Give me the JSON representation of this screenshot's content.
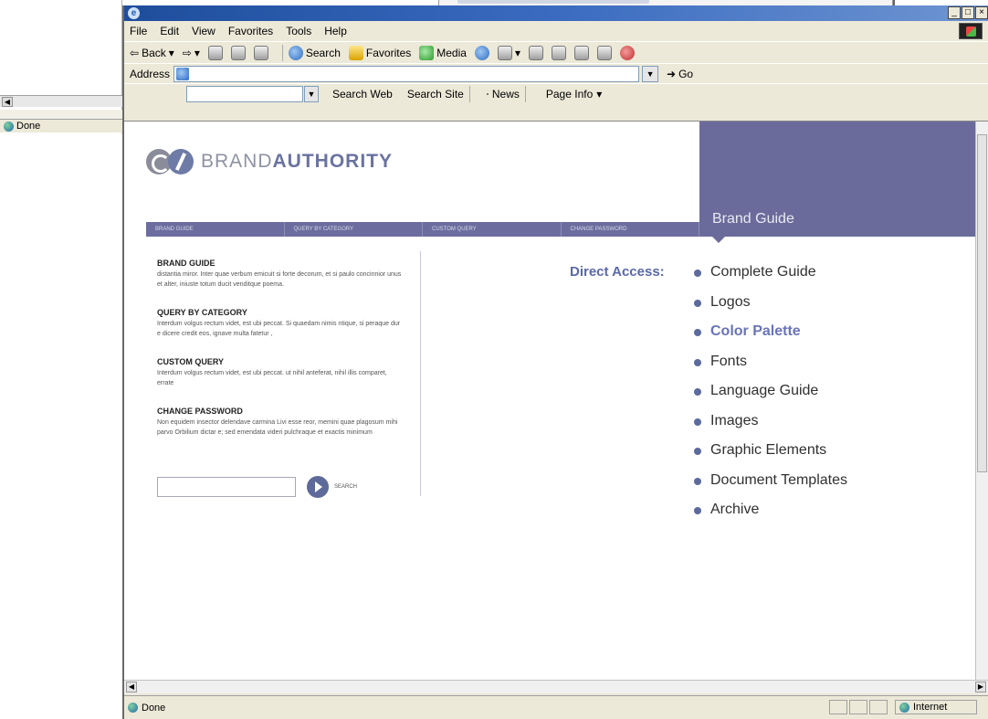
{
  "background_window": {
    "status": "Done"
  },
  "browser": {
    "menu": [
      "File",
      "Edit",
      "View",
      "Favorites",
      "Tools",
      "Help"
    ],
    "toolbar": {
      "back": "Back",
      "search": "Search",
      "favorites": "Favorites",
      "media": "Media"
    },
    "address_label": "Address",
    "address_value": "",
    "go": "Go",
    "links": {
      "search_web": "Search Web",
      "search_site": "Search Site",
      "news": "News",
      "page_info": "Page Info"
    },
    "status": "Done",
    "zone": "Internet"
  },
  "page": {
    "brand_light": "BRAND",
    "brand_bold": "AUTHORITY",
    "nav": [
      "BRAND GUIDE",
      "QUERY BY CATEGORY",
      "CUSTOM QUERY",
      "CHANGE PASSWORD"
    ],
    "panel_title": "Brand Guide",
    "sections": [
      {
        "title": "BRAND GUIDE",
        "body": "distantia miror. Inter quae verbum emicuit si forte decorum, et si paulo concinnior unus et alter, iniuste totum ducit venditque poema."
      },
      {
        "title": "QUERY BY CATEGORY",
        "body": "Interdum volgus rectum videt, est ubi peccat. Si quaedam nimis ntique, si peraque dur e dicere credit eos, ignave multa fatetur ,"
      },
      {
        "title": "CUSTOM QUERY",
        "body": "Interdum volgus rectum videt, est ubi peccat. ut nihil anteferat, nihil illis comparet, errate"
      },
      {
        "title": "CHANGE PASSWORD",
        "body": "Non equidem insector delendave carmina Livi esse reor, memini quae plagosum mihi parvo Orbilium dictar e; sed emendata videri pulchraque et exactis minimum"
      }
    ],
    "search_label": "SEARCH",
    "direct_access": "Direct Access:",
    "access_links": [
      "Complete Guide",
      "Logos",
      "Color Palette",
      "Fonts",
      "Language Guide",
      "Images",
      "Graphic Elements",
      "Document Templates",
      "Archive"
    ],
    "colors": {
      "brand_purple": "#6b6b9b",
      "accent_blue": "#5a69a8",
      "active_link": "#6a74b6"
    }
  }
}
